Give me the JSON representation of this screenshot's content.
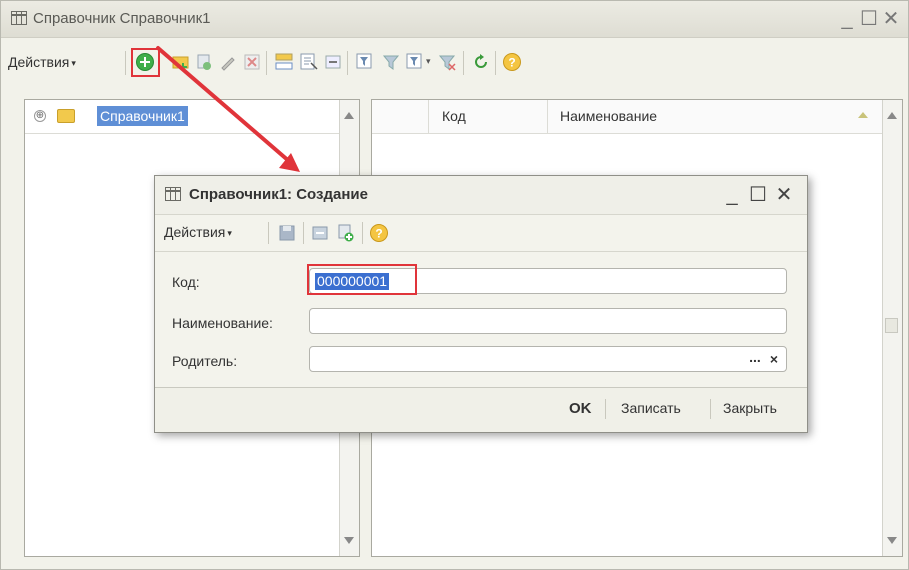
{
  "window": {
    "title": "Справочник Справочник1",
    "minimize": "_",
    "maximize": "☐",
    "close": "✕"
  },
  "toolbar": {
    "actions_label": "Действия",
    "caret": "▾"
  },
  "tree": {
    "expand_symbol": "⊕",
    "root_label": "Справочник1"
  },
  "grid": {
    "columns": [
      "Код",
      "Наименование"
    ]
  },
  "dialog": {
    "title": "Справочник1: Создание",
    "minimize": "_",
    "maximize": "☐",
    "close": "✕",
    "actions_label": "Действия",
    "caret": "▾",
    "fields": {
      "code_label": "Код:",
      "code_value": "000000001",
      "name_label": "Наименование:",
      "name_value": "",
      "parent_label": "Родитель:",
      "parent_value": "",
      "select_button": "...",
      "clear_button": "×"
    },
    "buttons": {
      "ok": "OK",
      "save": "Записать",
      "close": "Закрыть"
    }
  },
  "colors": {
    "highlight": "#e0343a",
    "selection": "#3b6fd0",
    "add_icon": "#3fae4a"
  }
}
